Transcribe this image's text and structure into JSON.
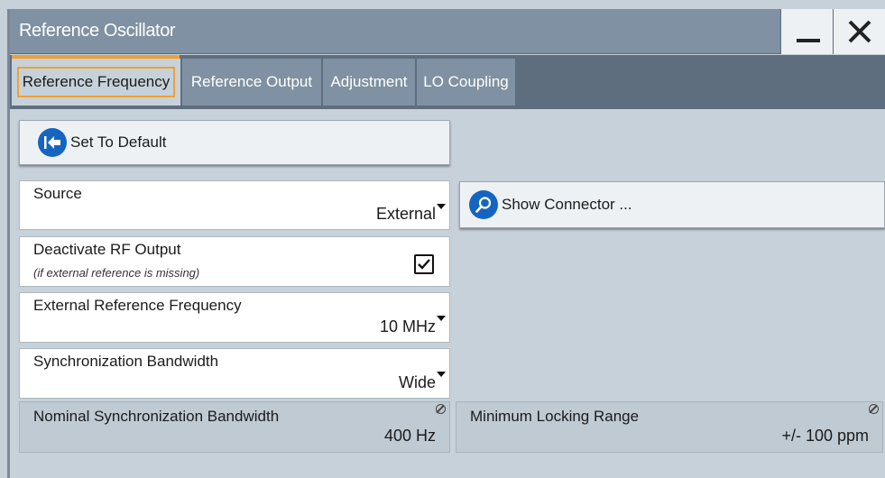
{
  "window": {
    "title": "Reference Oscillator"
  },
  "tabs": [
    {
      "label": "Reference Frequency",
      "active": true
    },
    {
      "label": "Reference Output",
      "active": false
    },
    {
      "label": "Adjustment",
      "active": false
    },
    {
      "label": "LO Coupling",
      "active": false
    }
  ],
  "buttons": {
    "set_to_default": "Set To Default",
    "show_connector": "Show Connector ..."
  },
  "fields": {
    "source": {
      "label": "Source",
      "value": "External"
    },
    "deactivate_rf": {
      "label": "Deactivate RF Output",
      "sublabel": "(if external reference is missing)",
      "checked": true
    },
    "ext_ref_freq": {
      "label": "External Reference Frequency",
      "value": "10 MHz"
    },
    "sync_bandwidth": {
      "label": "Synchronization Bandwidth",
      "value": "Wide"
    },
    "nominal_sync_bw": {
      "label": "Nominal Synchronization Bandwidth",
      "value": "400 Hz"
    },
    "min_locking_range": {
      "label": "Minimum Locking Range",
      "value": "+/- 100 ppm"
    }
  },
  "icons": {
    "minimize": "minimize-icon",
    "close": "close-icon",
    "default": "back-to-start-icon",
    "connector": "search-icon",
    "lock": "read-only-icon"
  },
  "colors": {
    "titlebar": "#7f91a2",
    "tab_active_border": "#f0a030",
    "icon_blue": "#1565c0"
  }
}
